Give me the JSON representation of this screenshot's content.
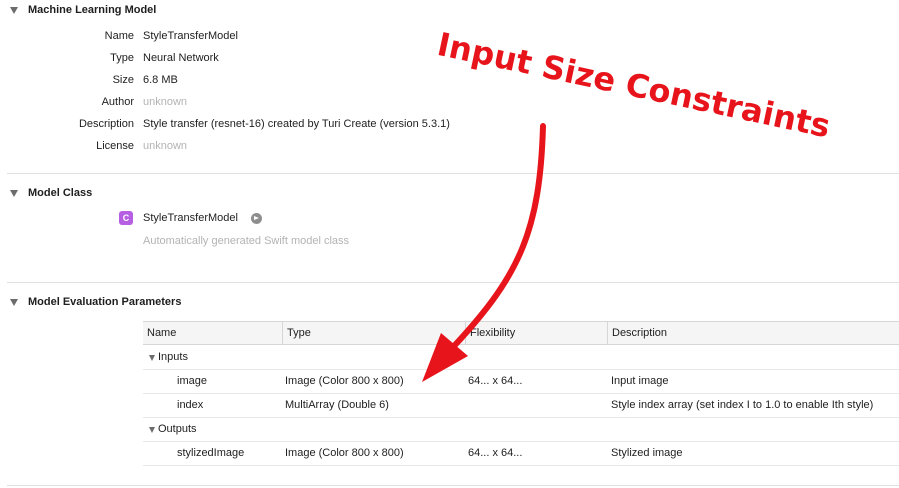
{
  "sections": {
    "ml_model": {
      "title": "Machine Learning Model",
      "properties": [
        {
          "label": "Name",
          "value": "StyleTransferModel",
          "muted": false
        },
        {
          "label": "Type",
          "value": "Neural Network",
          "muted": false
        },
        {
          "label": "Size",
          "value": "6.8 MB",
          "muted": false
        },
        {
          "label": "Author",
          "value": "unknown",
          "muted": true
        },
        {
          "label": "Description",
          "value": "Style transfer (resnet-16) created by Turi Create (version 5.3.1)",
          "muted": false
        },
        {
          "label": "License",
          "value": "unknown",
          "muted": true
        }
      ]
    },
    "model_class": {
      "title": "Model Class",
      "badge": "C",
      "class_name": "StyleTransferModel",
      "subtitle": "Automatically generated Swift model class"
    },
    "eval_params": {
      "title": "Model Evaluation Parameters",
      "columns": [
        "Name",
        "Type",
        "Flexibility",
        "Description"
      ],
      "groups": [
        {
          "label": "Inputs",
          "rows": [
            {
              "name": "image",
              "type": "Image (Color 800 x 800)",
              "flexibility": "64... x 64...",
              "description": "Input image"
            },
            {
              "name": "index",
              "type": "MultiArray (Double 6)",
              "flexibility": "",
              "description": "Style index array (set index I to 1.0 to enable Ith style)"
            }
          ]
        },
        {
          "label": "Outputs",
          "rows": [
            {
              "name": "stylizedImage",
              "type": "Image (Color 800 x 800)",
              "flexibility": "64... x 64...",
              "description": "Stylized image"
            }
          ]
        }
      ]
    }
  },
  "annotation": {
    "text": "Input Size Constraints",
    "color": "#e8141b"
  },
  "icons": {
    "disclosure": "disclosure-triangle-icon",
    "class_badge": "swift-class-icon",
    "navigate": "go-arrow-circle-icon"
  }
}
